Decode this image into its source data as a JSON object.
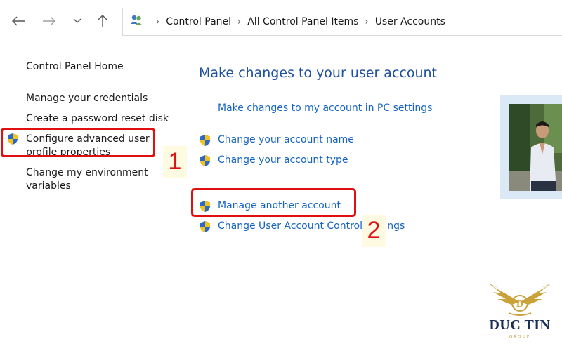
{
  "breadcrumb": {
    "items": [
      "Control Panel",
      "All Control Panel Items",
      "User Accounts"
    ]
  },
  "icons": {
    "back": "arrow-left-icon",
    "forward": "arrow-right-icon",
    "recent": "chevron-down-icon",
    "up": "arrow-up-icon",
    "location": "users-icon",
    "uac": "uac-shield-icon"
  },
  "sidebar": {
    "items": [
      {
        "label": "Control Panel Home"
      },
      {
        "label": "Manage your credentials"
      },
      {
        "label": "Create a password reset disk"
      },
      {
        "label_line1": "Configure advanced user",
        "label_line2": "profile properties",
        "shield": true
      },
      {
        "label_line1": "Change my environment",
        "label_line2": "variables"
      }
    ]
  },
  "main": {
    "title": "Make changes to your user account",
    "pc_settings_link": "Make changes to my account in PC settings",
    "actions": [
      {
        "label": "Change your account name",
        "shield": true
      },
      {
        "label": "Change your account type",
        "shield": true
      },
      {
        "label": "Manage another account",
        "shield": true
      },
      {
        "label": "Change User Account Control settings",
        "shield": true
      }
    ]
  },
  "annotations": {
    "step1": "1",
    "step2": "2",
    "highlight_color": "#e01010"
  },
  "logo": {
    "name": "DUC TIN",
    "sub": "GROUP",
    "monogram": "D"
  },
  "colors": {
    "link": "#1764c4",
    "title": "#1e4fa0",
    "picture_frame": "#dbe9f7",
    "logo_gold": "#c9a23a",
    "logo_navy": "#1b2e55"
  }
}
